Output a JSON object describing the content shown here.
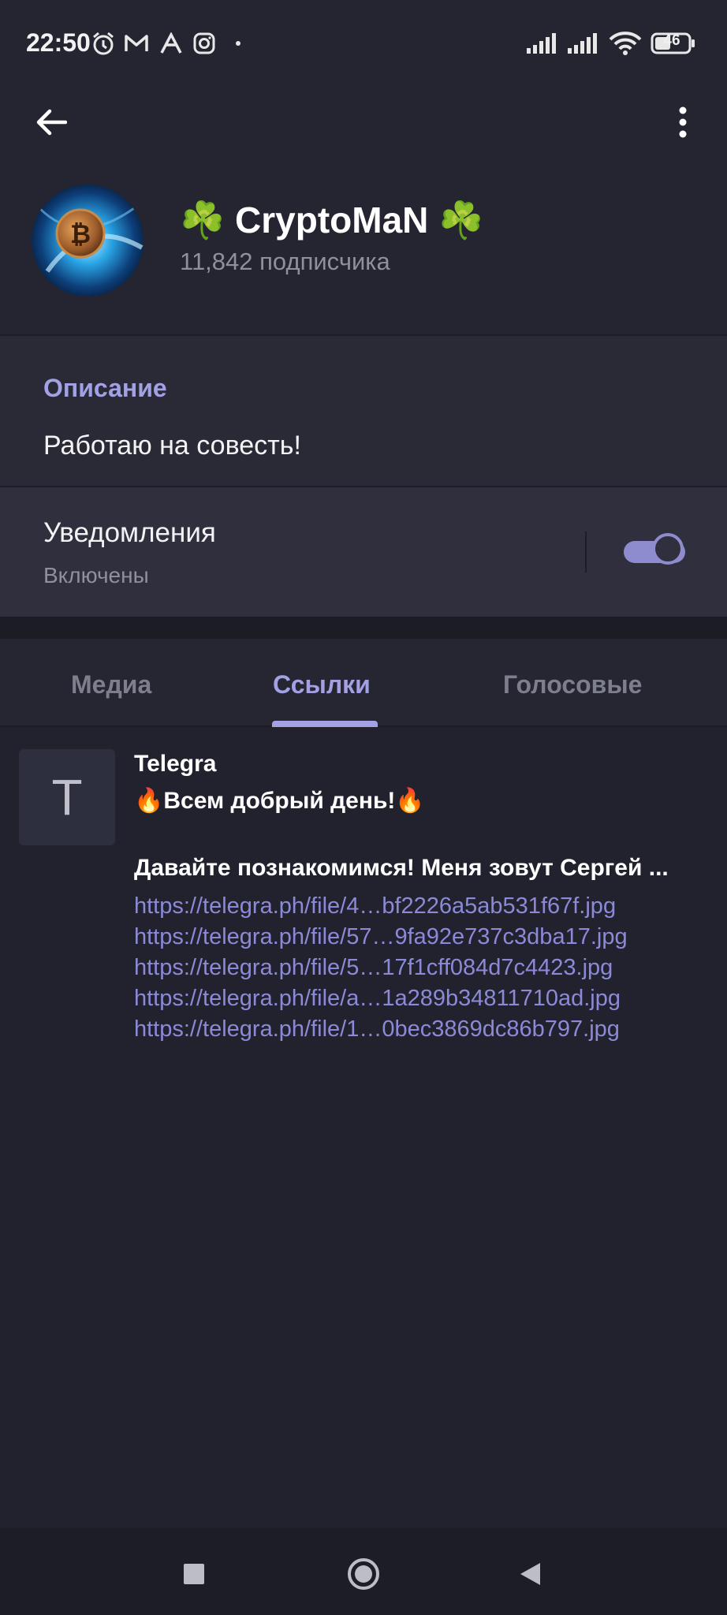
{
  "status_bar": {
    "time": "22:50",
    "battery": "46",
    "icons": [
      "alarm-icon",
      "gmail-icon",
      "app-icon",
      "instagram-icon",
      "dot-icon",
      "signal-icon",
      "signal-icon",
      "wifi-icon",
      "battery-icon"
    ]
  },
  "header": {
    "back_icon": "arrow-left-icon",
    "menu_icon": "more-vertical-icon",
    "title": "☘️ CryptoMaN ☘️",
    "subscribers": "11,842 подписчика"
  },
  "description": {
    "label": "Описание",
    "text": "Работаю на совесть!"
  },
  "notifications": {
    "label": "Уведомления",
    "status": "Включены",
    "enabled": true
  },
  "tabs": [
    {
      "label": "Медиа",
      "active": false
    },
    {
      "label": "Ссылки",
      "active": true
    },
    {
      "label": "Голосовые",
      "active": false
    }
  ],
  "link_item": {
    "thumb_letter": "T",
    "title": "Telegra",
    "line1": "🔥Всем добрый день!🔥",
    "line2": "Давайте познакомимся! Меня зовут Сергей ...",
    "urls": [
      "https://telegra.ph/file/4…bf2226a5ab531f67f.jpg",
      "https://telegra.ph/file/57…9fa92e737c3dba17.jpg",
      "https://telegra.ph/file/5…17f1cff084d7c4423.jpg",
      "https://telegra.ph/file/a…1a289b34811710ad.jpg",
      "https://telegra.ph/file/1…0bec3869dc86b797.jpg"
    ]
  },
  "nav": {
    "recents_icon": "square-icon",
    "home_icon": "circle-home-icon",
    "back_icon": "triangle-back-icon"
  },
  "colors": {
    "accent": "#a3a1e3",
    "link": "#8c8ad8",
    "background": "#22222e"
  }
}
